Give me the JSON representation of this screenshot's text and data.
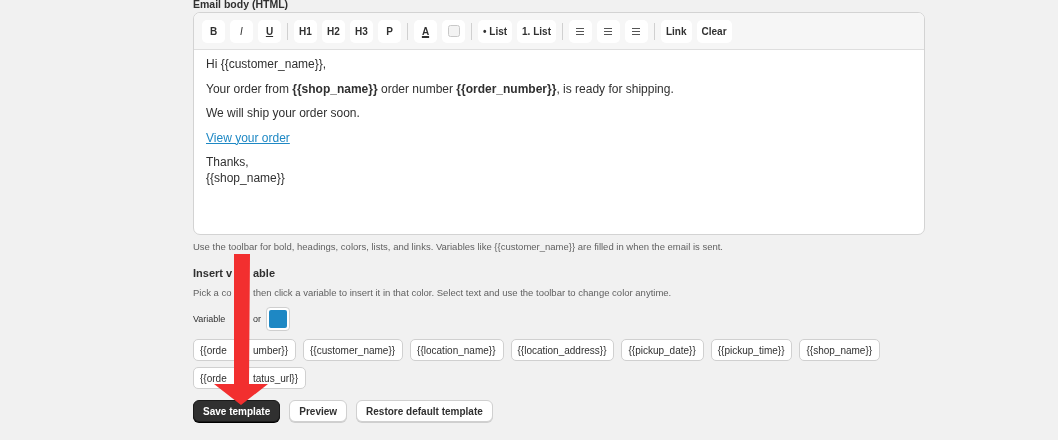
{
  "editor": {
    "label": "Email body (HTML)",
    "toolbar": [
      [
        {
          "kind": "bold",
          "label": "B"
        },
        {
          "kind": "italic",
          "label": "I"
        },
        {
          "kind": "underline",
          "label": "U"
        }
      ],
      [
        {
          "kind": "text",
          "label": "H1"
        },
        {
          "kind": "text",
          "label": "H2"
        },
        {
          "kind": "text",
          "label": "H3"
        },
        {
          "kind": "text",
          "label": "P"
        }
      ],
      [
        {
          "kind": "color",
          "label": "A"
        },
        {
          "kind": "highlight"
        }
      ],
      [
        {
          "kind": "text",
          "label": "• List"
        },
        {
          "kind": "text",
          "label": "1. List"
        }
      ],
      [
        {
          "kind": "align"
        },
        {
          "kind": "align"
        },
        {
          "kind": "align"
        }
      ],
      [
        {
          "kind": "text",
          "label": "Link"
        },
        {
          "kind": "text",
          "label": "Clear"
        }
      ]
    ],
    "body": [
      {
        "kind": "paragraph",
        "lines": [
          "Hi {{customer_name}},"
        ]
      },
      {
        "kind": "paragraph",
        "lines": [
          "Your order from **{{shop_name}}** order number **{{order_number}}**, is ready for shipping."
        ]
      },
      {
        "kind": "paragraph",
        "lines": [
          "We will ship your order soon."
        ]
      },
      {
        "kind": "link",
        "lines": [
          "View your order"
        ]
      },
      {
        "kind": "paragraph",
        "lines": [
          "Thanks,",
          "{{shop_name}}"
        ]
      }
    ],
    "help": "Use the toolbar for bold, headings, colors, lists, and links. Variables like {{customer_name}} are filled in when the email is sent."
  },
  "insert_variable": {
    "title": [
      "Insert v",
      "able"
    ],
    "description": [
      "Pick a co",
      "then click a variable to insert it in that color. Select text and use the toolbar to change color anytime."
    ],
    "color_label": [
      "Variable",
      "or"
    ],
    "color": "#1e88c4",
    "variables": [
      [
        "{{orde",
        "umber}}"
      ],
      [
        "{{customer_name}}"
      ],
      [
        "{{location_name}}"
      ],
      [
        "{{location_address}}"
      ],
      [
        "{{pickup_date}}"
      ],
      [
        "{{pickup_time}}"
      ],
      [
        "{{shop_name}}"
      ],
      [
        "{{orde",
        "tatus_url}}"
      ]
    ]
  },
  "actions": [
    {
      "label": "Save template",
      "primary": true
    },
    {
      "label": "Preview",
      "primary": false
    },
    {
      "label": "Restore default template",
      "primary": false
    }
  ]
}
